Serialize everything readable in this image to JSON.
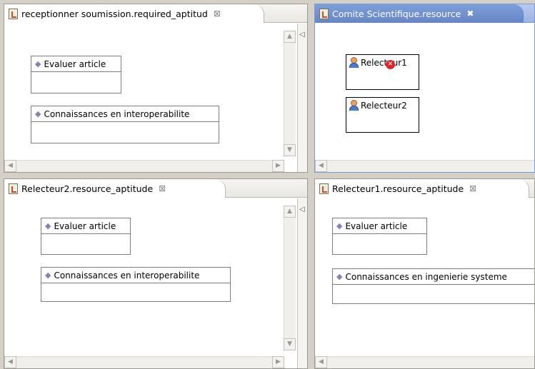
{
  "panes": {
    "top_left": {
      "tab_title": "receptionner soumission.required_aptitud",
      "close_glyph": "⊠",
      "boxes": [
        {
          "label": "Evaluer article"
        },
        {
          "label": "Connaissances en interoperabilite"
        }
      ]
    },
    "top_right": {
      "tab_title": "Comite Scientifique.resource",
      "close_glyph": "✖",
      "resources": [
        {
          "label": "Relecteur1",
          "has_error": true
        },
        {
          "label": "Relecteur2",
          "has_error": false
        }
      ]
    },
    "bottom_left": {
      "tab_title": "Relecteur2.resource_aptitude",
      "close_glyph": "⊠",
      "boxes": [
        {
          "label": "Evaluer article"
        },
        {
          "label": "Connaissances en interoperabilite"
        }
      ]
    },
    "bottom_right": {
      "tab_title": "Relecteur1.resource_aptitude",
      "close_glyph": "⊠",
      "boxes": [
        {
          "label": "Evaluer article"
        },
        {
          "label": "Connaissances en ingenierie systeme"
        }
      ]
    }
  },
  "icons": {
    "tab": "diagram-file-icon",
    "aptitude": "diamond-icon",
    "resource": "person-icon",
    "error": "error-icon"
  },
  "colors": {
    "active_tab": "#6585c6",
    "error": "#e3242b",
    "aptitude_diamond": "#8a7fb6"
  }
}
